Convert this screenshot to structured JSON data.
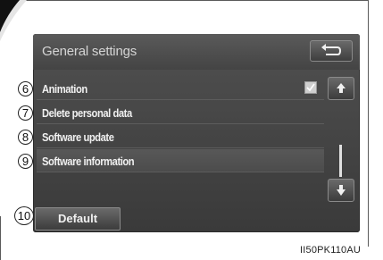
{
  "screen": {
    "title": "General settings",
    "back_icon": "return-arrow-icon"
  },
  "rows": [
    {
      "callout": "6",
      "label": "Animation",
      "checked": true
    },
    {
      "callout": "7",
      "label": "Delete personal data"
    },
    {
      "callout": "8",
      "label": "Software update"
    },
    {
      "callout": "9",
      "label": "Software information"
    }
  ],
  "scroll": {
    "up_icon": "scroll-up-arrow-icon",
    "down_icon": "scroll-down-arrow-icon"
  },
  "default_button": {
    "callout": "10",
    "label": "Default"
  },
  "figure_code": "II50PK110AU"
}
